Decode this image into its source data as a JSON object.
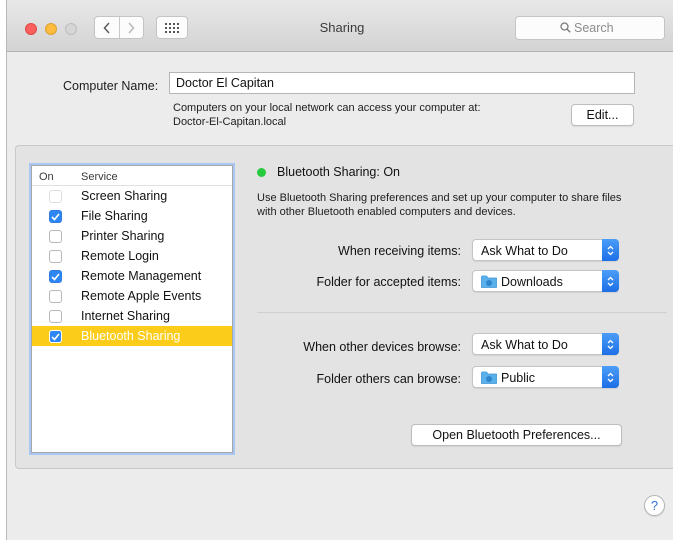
{
  "window": {
    "title": "Sharing",
    "search_placeholder": "Search"
  },
  "computer_name": {
    "label": "Computer Name:",
    "value": "Doctor El Capitan",
    "description_line1": "Computers on your local network can access your computer at:",
    "description_line2": "Doctor-El-Capitan.local",
    "edit_label": "Edit..."
  },
  "service_list": {
    "header_on": "On",
    "header_service": "Service",
    "items": [
      {
        "label": "Screen Sharing",
        "checked": false
      },
      {
        "label": "File Sharing",
        "checked": true
      },
      {
        "label": "Printer Sharing",
        "checked": false
      },
      {
        "label": "Remote Login",
        "checked": false
      },
      {
        "label": "Remote Management",
        "checked": true
      },
      {
        "label": "Remote Apple Events",
        "checked": false
      },
      {
        "label": "Internet Sharing",
        "checked": false
      },
      {
        "label": "Bluetooth Sharing",
        "checked": true,
        "selected": true
      }
    ]
  },
  "detail": {
    "status": "Bluetooth Sharing: On",
    "status_color": "#27c93f",
    "description_line1": "Use Bluetooth Sharing preferences and set up your computer to share files",
    "description_line2": "with other Bluetooth enabled computers and devices.",
    "receiving_label": "When receiving items:",
    "receiving_value": "Ask What to Do",
    "accepted_folder_label": "Folder for accepted items:",
    "accepted_folder_value": "Downloads",
    "browse_label": "When other devices browse:",
    "browse_value": "Ask What to Do",
    "browse_folder_label": "Folder others can browse:",
    "browse_folder_value": "Public",
    "open_prefs_label": "Open Bluetooth Preferences..."
  },
  "help_label": "?",
  "colors": {
    "selection": "#fccc1a",
    "accent_blue": "#2e86f5",
    "focus_ring": "#a9c7f0"
  }
}
